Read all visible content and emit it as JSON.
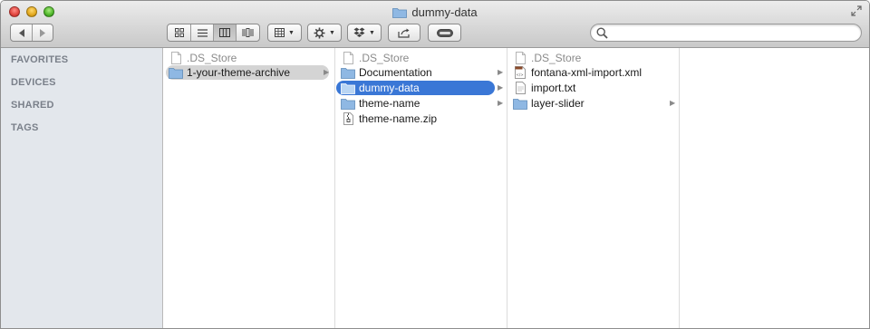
{
  "window": {
    "title": "dummy-data"
  },
  "toolbar": {
    "view_buttons": [
      "icon-view",
      "list-view",
      "column-view",
      "cover-flow-view"
    ],
    "arrange_icon": "arrange-icon",
    "action_icon": "gear-icon",
    "dropbox_icon": "dropbox-icon",
    "share_icon": "share-icon",
    "tags_icon": "tags-icon"
  },
  "search": {
    "placeholder": ""
  },
  "sidebar": {
    "headings": [
      "FAVORITES",
      "DEVICES",
      "SHARED",
      "TAGS"
    ]
  },
  "columns": [
    {
      "items": [
        {
          "name": ".DS_Store",
          "type": "file",
          "dim": true
        },
        {
          "name": "1-your-theme-archive",
          "type": "folder",
          "selected": "gray",
          "has_children": true
        }
      ]
    },
    {
      "items": [
        {
          "name": ".DS_Store",
          "type": "file",
          "dim": true
        },
        {
          "name": "Documentation",
          "type": "folder",
          "has_children": true
        },
        {
          "name": "dummy-data",
          "type": "folder",
          "selected": "blue",
          "has_children": true
        },
        {
          "name": "theme-name",
          "type": "folder",
          "has_children": true
        },
        {
          "name": "theme-name.zip",
          "type": "zip"
        }
      ]
    },
    {
      "items": [
        {
          "name": ".DS_Store",
          "type": "file",
          "dim": true
        },
        {
          "name": "fontana-xml-import.xml",
          "type": "xml"
        },
        {
          "name": "import.txt",
          "type": "file"
        },
        {
          "name": "layer-slider",
          "type": "folder",
          "has_children": true
        }
      ]
    }
  ],
  "colors": {
    "selection_blue": "#3a77d6",
    "selection_gray": "#d4d4d4",
    "sidebar_bg": "#e3e7ec",
    "folder_blue": "#8fb8e3"
  }
}
